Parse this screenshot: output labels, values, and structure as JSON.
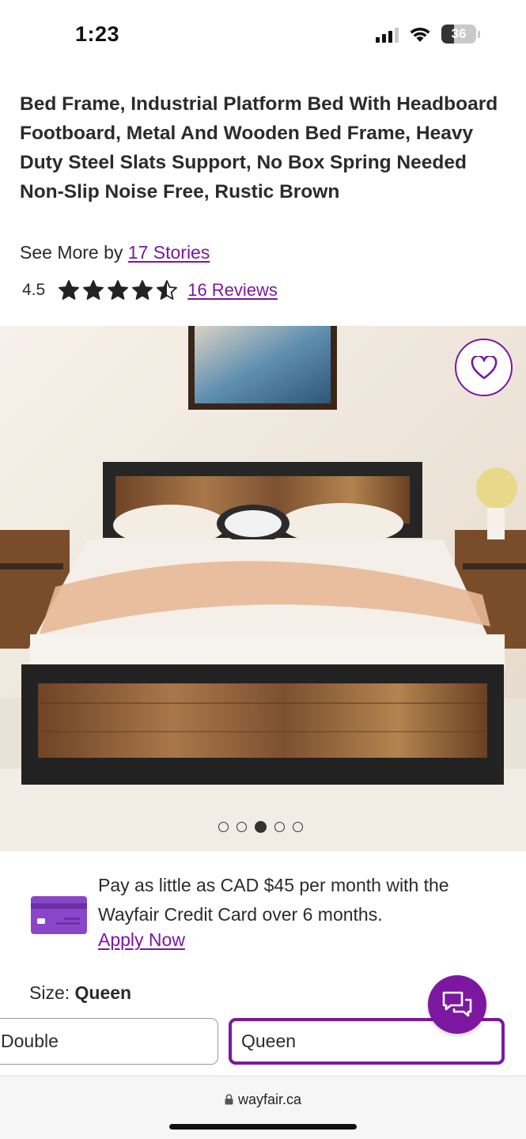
{
  "status_bar": {
    "time": "1:23",
    "battery": "36",
    "signal_bars": 3
  },
  "product": {
    "title": "Bed Frame, Industrial Platform Bed With Headboard Footboard, Metal And Wooden Bed Frame, Heavy Duty Steel Slats Support, No Box Spring Needed Non-Slip Noise Free, Rustic Brown",
    "see_more_prefix": "See More by",
    "brand": "17 Stories",
    "rating": "4.5",
    "rating_value": 4.5,
    "reviews_label": "16 Reviews"
  },
  "gallery": {
    "total_images": 5,
    "active_index": 2
  },
  "financing": {
    "text": "Pay as little as CAD $45 per month with the Wayfair Credit Card over 6 months.",
    "apply_label": "Apply Now"
  },
  "size": {
    "label": "Size:",
    "selected": "Queen",
    "options": [
      {
        "label": "Double",
        "selected": false
      },
      {
        "label": "Queen",
        "selected": true
      }
    ]
  },
  "browser": {
    "url": "wayfair.ca"
  },
  "icons": {
    "favorite": "heart-icon",
    "chat": "chat-bubbles-icon",
    "card": "credit-card-icon",
    "lock": "lock-icon",
    "star": "star-icon"
  },
  "colors": {
    "accent": "#7b189f",
    "text": "#2b2b2b",
    "card_purple": "#8a46c8"
  }
}
